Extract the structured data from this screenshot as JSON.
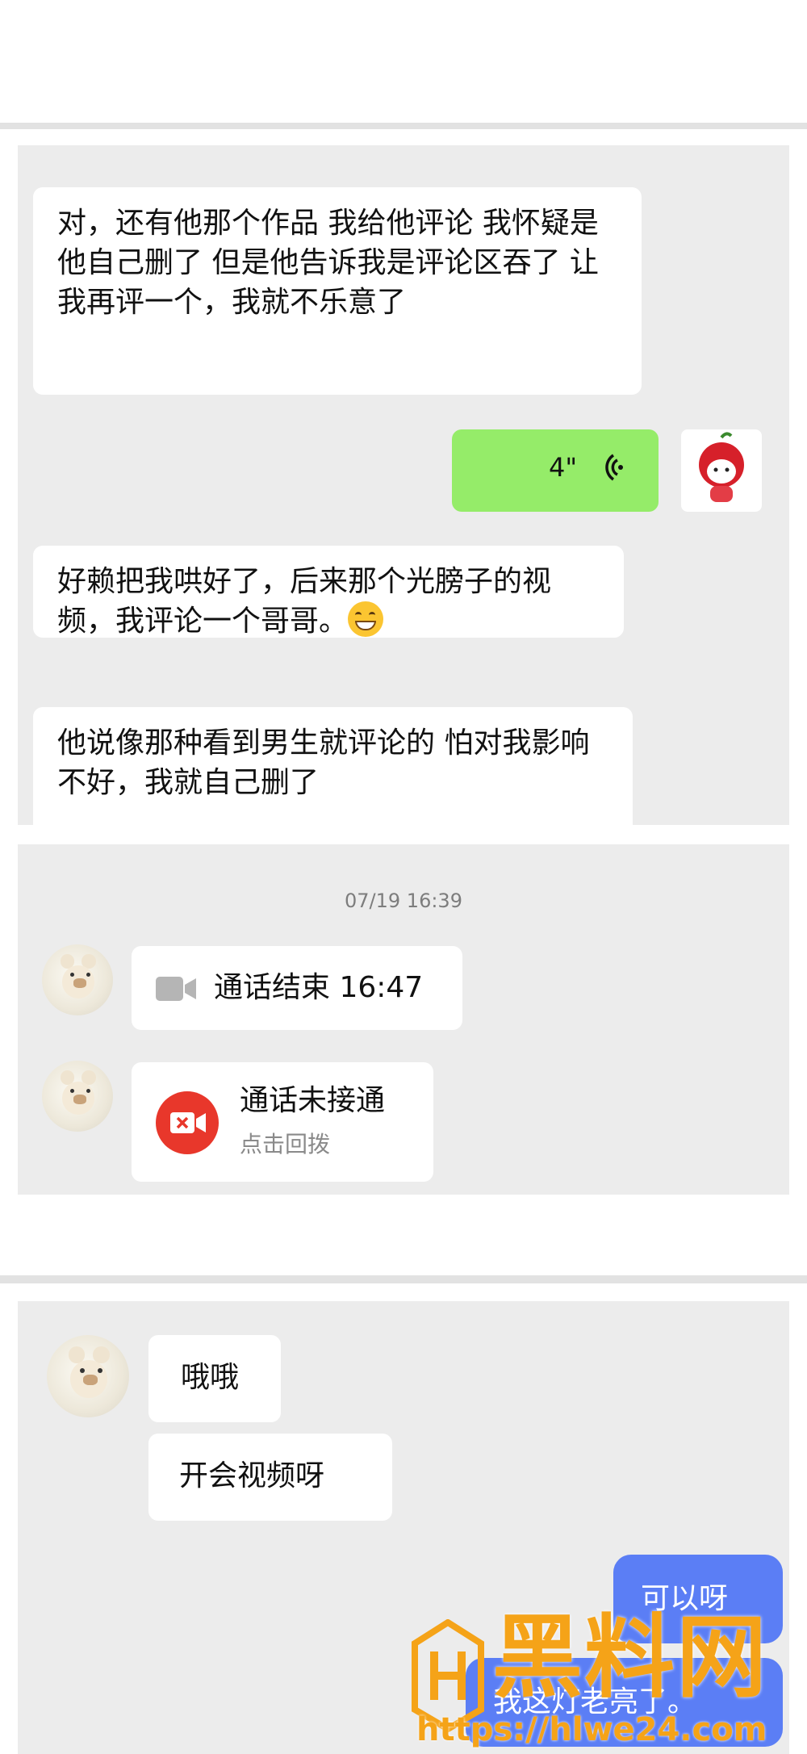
{
  "panel1": {
    "msg_recv_1": "对，还有他那个作品 我给他评论  我怀疑是他自己删了  但是他告诉我是评论区吞了 让我再评一个，我就不乐意了",
    "voice_duration": "4\"",
    "msg_recv_2": "好赖把我哄好了，后来那个光膀子的视频，我评论一个哥哥。",
    "msg_recv_3": "他说像那种看到男生就评论的 怕对我影响不好，我就自己删了"
  },
  "panel2": {
    "timestamp": "07/19 16:39",
    "call_ended": "通话结束 16:47",
    "call_missed": "通话未接通",
    "call_back": "点击回拨"
  },
  "panel3": {
    "msg_recv_1": "哦哦",
    "msg_recv_2": "开会视频呀",
    "msg_sent_1": "可以呀",
    "msg_sent_2": "我这灯老亮了。"
  },
  "watermark": {
    "brand": "黑料网",
    "url": "https://hlwe24.com"
  },
  "colors": {
    "sent_green": "#95ec69",
    "sent_blue": "#5b7ef5",
    "call_red": "#e8372b",
    "watermark_orange": "#f5a318"
  }
}
